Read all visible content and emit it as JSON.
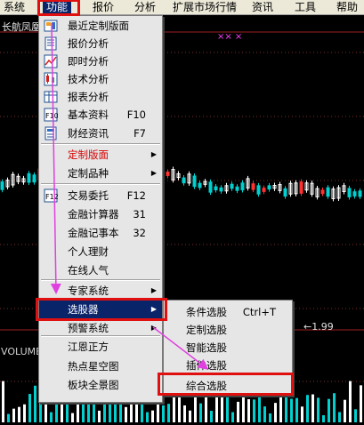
{
  "menubar": {
    "items": [
      "系统",
      "功能",
      "报价",
      "分析",
      "扩展市场行情",
      "资讯",
      "工具",
      "帮助"
    ]
  },
  "chart": {
    "stock_title": "长航凤凰",
    "volume_label": "VOLUME",
    "price_label": "←1.99",
    "markers": "×× ×"
  },
  "main_menu": {
    "items": [
      {
        "label": "最近定制版面",
        "icon": "layout-icon"
      },
      {
        "label": "报价分析",
        "icon": "quote-icon"
      },
      {
        "label": "即时分析",
        "icon": "realtime-chart-icon"
      },
      {
        "label": "技术分析",
        "icon": "candlestick-icon"
      },
      {
        "label": "报表分析",
        "icon": "report-icon"
      },
      {
        "label": "基本资料",
        "shortcut": "F10",
        "icon": "f10-icon"
      },
      {
        "label": "财经资讯",
        "shortcut": "F7",
        "icon": "news-icon"
      },
      {
        "label": "定制版面"
      },
      {
        "label": "定制品种"
      },
      {
        "label": "交易委托",
        "shortcut": "F12",
        "icon": "f12-icon"
      },
      {
        "label": "金融计算器",
        "shortcut": "31"
      },
      {
        "label": "金融记事本",
        "shortcut": "32"
      },
      {
        "label": "个人理财"
      },
      {
        "label": "在线人气"
      },
      {
        "label": "专家系统"
      },
      {
        "label": "选股器"
      },
      {
        "label": "预警系统"
      },
      {
        "label": "江恩正方"
      },
      {
        "label": "热点星空图"
      },
      {
        "label": "板块全景图"
      }
    ]
  },
  "sub_menu": {
    "items": [
      {
        "label": "条件选股",
        "shortcut": "Ctrl+T"
      },
      {
        "label": "定制选股"
      },
      {
        "label": "智能选股"
      },
      {
        "label": "插件选股"
      },
      {
        "label": "综合选股"
      }
    ]
  },
  "colors": {
    "menu_bg": "#e6e6e6",
    "highlight": "#0a246a",
    "red_box": "#e01010",
    "arrow": "#e040e0",
    "candle_up": "#ffffff",
    "candle_down": "#00d0d0",
    "candle_red": "#ff3030"
  }
}
